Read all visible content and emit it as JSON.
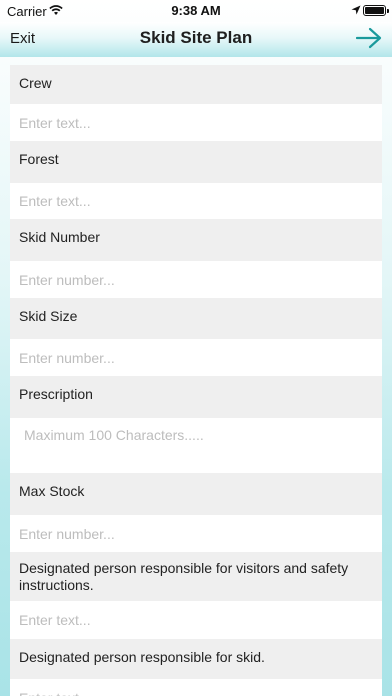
{
  "status_bar": {
    "carrier": "Carrier",
    "time": "9:38 AM"
  },
  "navbar": {
    "exit_label": "Exit",
    "title": "Skid Site Plan",
    "next_icon": "arrow-right-icon"
  },
  "form": {
    "fields": [
      {
        "label": "Crew",
        "placeholder": "Enter text..."
      },
      {
        "label": "Forest",
        "placeholder": "Enter text..."
      },
      {
        "label": "Skid Number",
        "placeholder": "Enter number..."
      },
      {
        "label": "Skid Size",
        "placeholder": "Enter number..."
      },
      {
        "label": "Prescription",
        "placeholder": "Maximum 100 Characters....."
      },
      {
        "label": "Max Stock",
        "placeholder": "Enter number..."
      },
      {
        "label": "Designated person responsible for visitors and safety instructions.",
        "placeholder": "Enter text..."
      },
      {
        "label": "Designated person responsible for skid.",
        "placeholder": "Enter text..."
      }
    ]
  },
  "colors": {
    "accent_teal": "#1aa7a7",
    "row_label_bg": "#efefef",
    "placeholder": "#bdbdbd"
  }
}
